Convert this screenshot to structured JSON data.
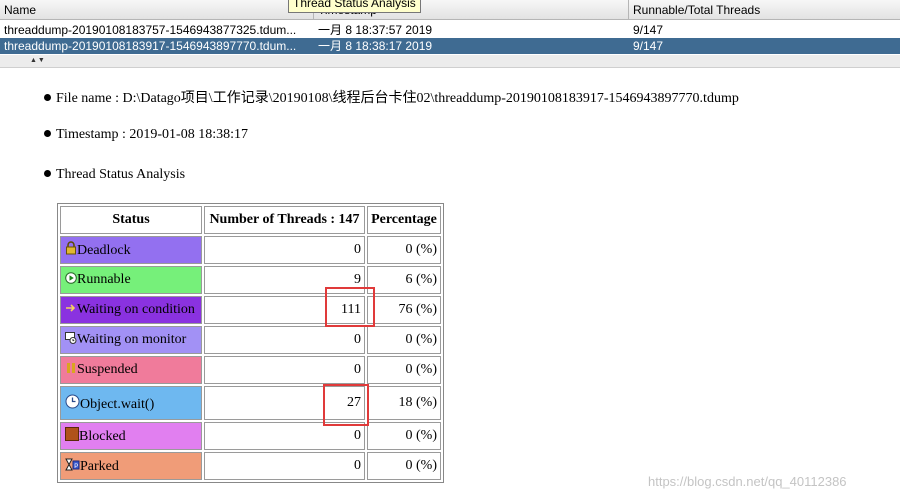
{
  "thread_dumps_table": {
    "headers": [
      "Name",
      "Timestamp",
      "Runnable/Total Threads"
    ],
    "tooltip": "Thread Status Analysis",
    "rows": [
      {
        "name": "threaddump-20190108183757-1546943877325.tdum...",
        "timestamp": "一月 8 18:37:57 2019",
        "threads": "9/147"
      },
      {
        "name": "threaddump-20190108183917-1546943897770.tdum...",
        "timestamp": "一月 8 18:38:17 2019",
        "threads": "9/147"
      }
    ]
  },
  "details": {
    "file_name": "File name : D:\\Datago项目\\工作记录\\20190108\\线程后台卡住02\\threaddump-20190108183917-1546943897770.tdump",
    "timestamp": "Timestamp : 2019-01-08 18:38:17",
    "section_title": "Thread Status Analysis"
  },
  "status_table": {
    "headers": {
      "status": "Status",
      "count": "Number of Threads : 147",
      "percentage": "Percentage"
    },
    "rows": [
      {
        "status": "Deadlock",
        "count": "0",
        "percentage": "0 (%)",
        "color": "#9370f0",
        "icon": "lock-icon"
      },
      {
        "status": "Runnable",
        "count": "9",
        "percentage": "6 (%)",
        "color": "#76f07a",
        "icon": "play-icon"
      },
      {
        "status": "Waiting on condition",
        "count": "111",
        "percentage": "76 (%)",
        "color": "#8a32e0",
        "icon": "arrow-icon"
      },
      {
        "status": "Waiting on monitor",
        "count": "0",
        "percentage": "0 (%)",
        "color": "#a291f5",
        "icon": "monitor-icon"
      },
      {
        "status": "Suspended",
        "count": "0",
        "percentage": "0 (%)",
        "color": "#f07b9b",
        "icon": "pause-icon"
      },
      {
        "status": "Object.wait()",
        "count": "27",
        "percentage": "18 (%)",
        "color": "#6eb8f0",
        "icon": "clock-icon"
      },
      {
        "status": "Blocked",
        "count": "0",
        "percentage": "0 (%)",
        "color": "#e17ff0",
        "icon": "block-icon"
      },
      {
        "status": "Parked",
        "count": "0",
        "percentage": "0 (%)",
        "color": "#f09c78",
        "icon": "hourglass-icon"
      }
    ]
  },
  "watermark": "https://blog.csdn.net/qq_40112386"
}
